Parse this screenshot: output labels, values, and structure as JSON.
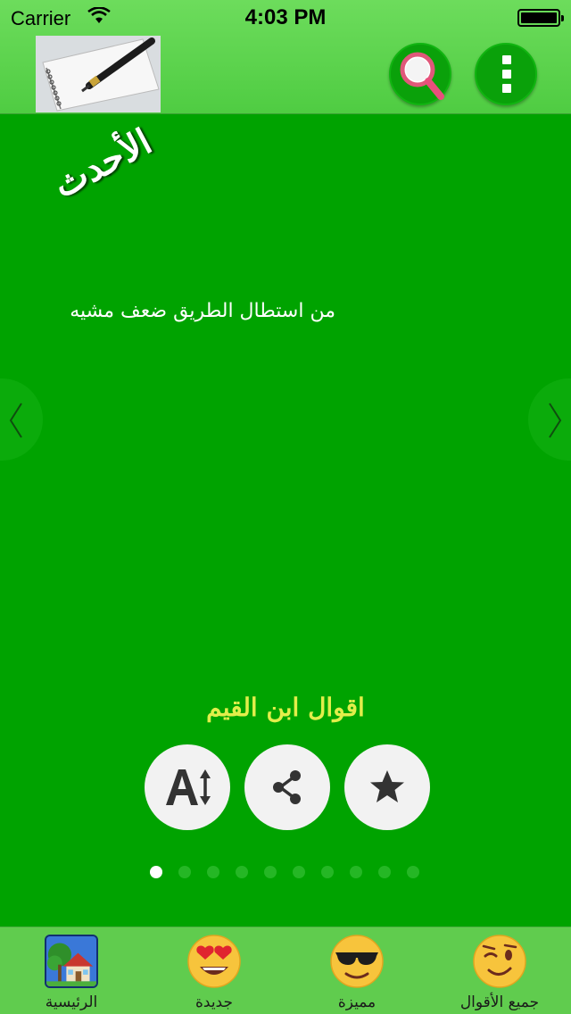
{
  "status_bar": {
    "carrier": "Carrier",
    "time": "4:03 PM",
    "wifi_icon": "wifi-icon",
    "battery_icon": "battery-icon"
  },
  "header": {
    "logo_icon": "notebook-pen-icon",
    "search_icon": "search-icon",
    "menu_icon": "more-vertical-icon"
  },
  "main": {
    "section_title": "الأحدث",
    "quote_text": "من استطال الطريق ضعف مشيه",
    "author": "اقوال ابن القيم",
    "prev_icon": "chevron-left-icon",
    "next_icon": "chevron-right-icon",
    "actions": [
      {
        "icon": "font-size-icon"
      },
      {
        "icon": "share-icon"
      },
      {
        "icon": "star-icon"
      }
    ],
    "pager": {
      "total": 10,
      "current": 1
    }
  },
  "tabbar": {
    "tabs": [
      {
        "label": "الرئيسية",
        "icon": "house-tree-icon",
        "active": true
      },
      {
        "label": "جديدة",
        "icon": "heart-eyes-emoji-icon",
        "active": false
      },
      {
        "label": "مميزة",
        "icon": "sunglasses-emoji-icon",
        "active": false
      },
      {
        "label": "جميع الأقوال",
        "icon": "wink-emoji-icon",
        "active": false
      }
    ]
  },
  "colors": {
    "background": "#00a300",
    "header": "#5fd54f",
    "author_text": "#e2ee4a",
    "tabbar": "#60cc4e"
  }
}
